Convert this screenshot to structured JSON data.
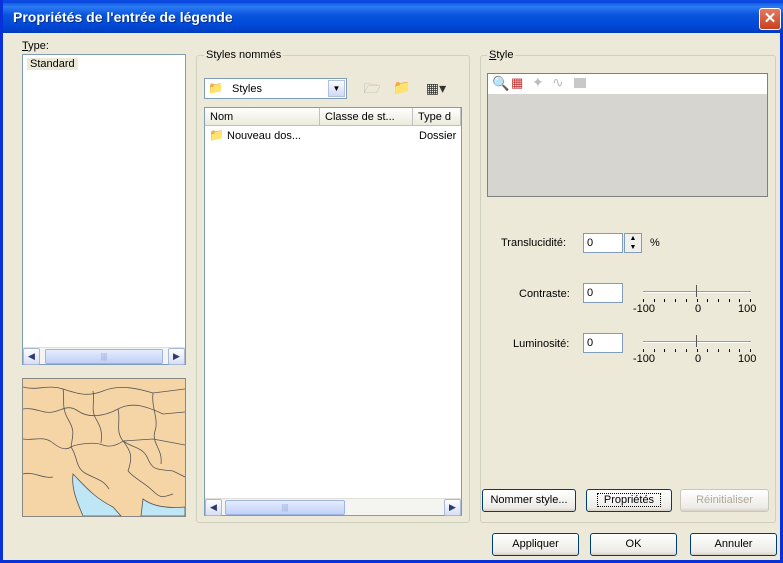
{
  "window": {
    "title": "Propriétés de l'entrée de légende",
    "close_glyph": "✕"
  },
  "type_panel": {
    "label": "Type:",
    "items": [
      "Standard"
    ]
  },
  "named_styles": {
    "label": "Styles nommés",
    "folder_select": {
      "value": "Styles"
    },
    "columns": [
      "Nom",
      "Classe de st...",
      "Type d"
    ],
    "rows": [
      {
        "name": "Nouveau dos...",
        "class": "",
        "type": "Dossier"
      }
    ]
  },
  "style_panel": {
    "label": "Style",
    "toolbar_icons": [
      "magnifier-icon",
      "grid-icon",
      "point-icon",
      "line-icon",
      "fill-icon"
    ],
    "translucency": {
      "label": "Translucidité:",
      "value": "0",
      "unit": "%"
    },
    "contrast": {
      "label": "Contraste:",
      "value": "0",
      "slider_value": 0,
      "min_label": "-100",
      "mid_label": "0",
      "max_label": "100"
    },
    "brightness": {
      "label": "Luminosité:",
      "value": "0",
      "slider_value": 0,
      "min_label": "-100",
      "mid_label": "0",
      "max_label": "100"
    }
  },
  "buttons": {
    "name_style": "Nommer style...",
    "properties": "Propriétés",
    "reset": "Réinitialiser",
    "apply": "Appliquer",
    "ok": "OK",
    "cancel": "Annuler"
  },
  "colors": {
    "titlebar": "#0054e3",
    "face": "#ece9d8",
    "map_land": "#f5d5a5"
  }
}
